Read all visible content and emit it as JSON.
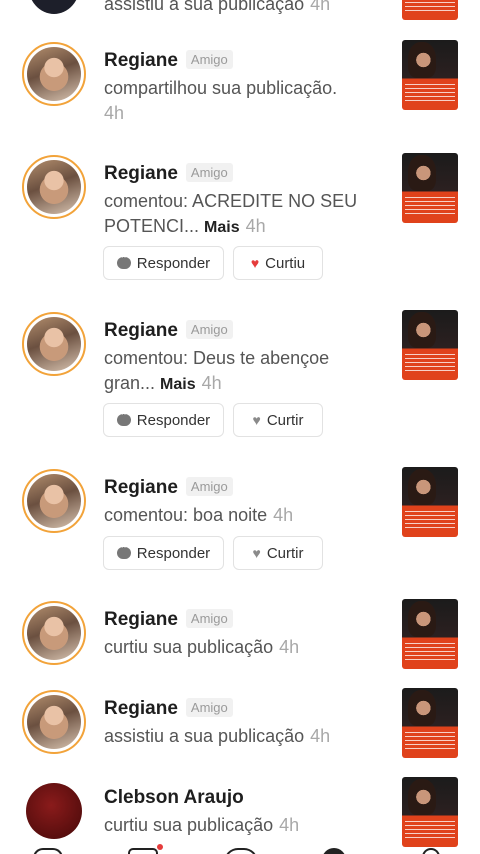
{
  "notifications": [
    {
      "name": "",
      "badge": "",
      "action": "assistiu a sua publicação",
      "more": "",
      "time": "4h",
      "buttons": false
    },
    {
      "name": "Regiane",
      "badge": "Amigo",
      "action": "compartilhou sua publicação.",
      "more": "",
      "time": "4h",
      "buttons": false
    },
    {
      "name": "Regiane",
      "badge": "Amigo",
      "action": "comentou: ACREDITE NO SEU POTENCI...",
      "more": "Mais",
      "time": "4h",
      "buttons": true,
      "liked": true
    },
    {
      "name": "Regiane",
      "badge": "Amigo",
      "action": "comentou: Deus te abençoe gran...",
      "more": "Mais",
      "time": "4h",
      "buttons": true,
      "liked": false
    },
    {
      "name": "Regiane",
      "badge": "Amigo",
      "action": "comentou: boa noite",
      "more": "",
      "time": "4h",
      "buttons": true,
      "liked": false
    },
    {
      "name": "Regiane",
      "badge": "Amigo",
      "action": "curtiu sua publicação",
      "more": "",
      "time": "4h",
      "buttons": false
    },
    {
      "name": "Regiane",
      "badge": "Amigo",
      "action": "assistiu a sua publicação",
      "more": "",
      "time": "4h",
      "buttons": false
    },
    {
      "name": "Clebson Araujo",
      "badge": "",
      "action": "curtiu sua publicação",
      "more": "",
      "time": "4h",
      "buttons": false
    }
  ],
  "labels": {
    "reply": "Responder",
    "liked": "Curtiu",
    "like": "Curtir"
  },
  "colors": {
    "avatar_ring": "#f2a33a",
    "liked_heart": "#e53b3b",
    "thumbnail_banner": "#e0421b"
  },
  "icons": [
    "comment-bubble-icon",
    "heart-icon",
    "home-icon",
    "inbox-icon",
    "create-icon",
    "profile-icon"
  ]
}
